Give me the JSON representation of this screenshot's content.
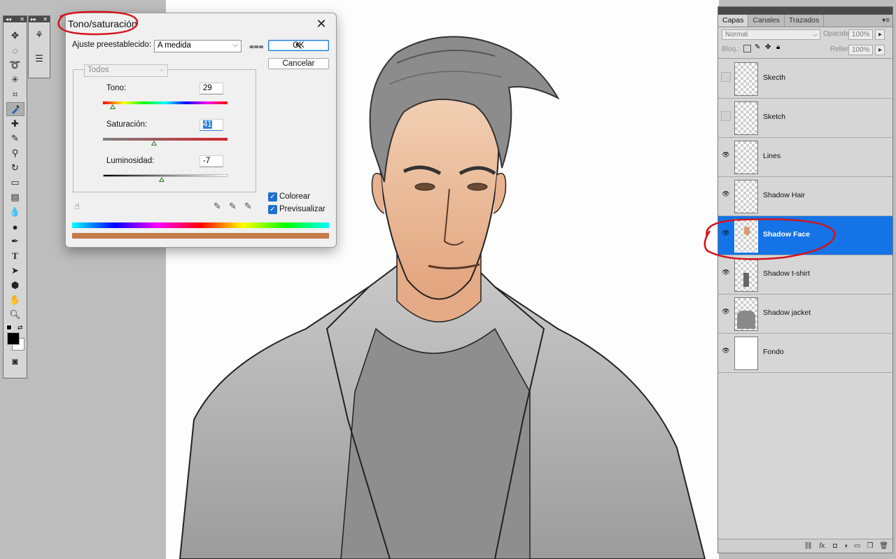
{
  "colors": {
    "accent": "#1473e6",
    "annotation": "#d4141a",
    "dialog_bg": "#f0f0f0",
    "panel_bg": "#d6d6d6",
    "colorize_sample": "#c27a49"
  },
  "dialog": {
    "title": "Tono/saturación",
    "preset_label": "Ajuste preestablecido:",
    "preset_value": "A medida",
    "channel_value": "Todos",
    "ok_label": "OK",
    "cancel_label": "Cancelar",
    "hue": {
      "label": "Tono:",
      "value": "29",
      "fraction": 0.08
    },
    "saturation": {
      "label": "Saturación:",
      "value": "41",
      "fraction": 0.41
    },
    "lightness": {
      "label": "Luminosidad:",
      "value": "-7",
      "fraction": 0.47
    },
    "colorize": {
      "label": "Colorear",
      "checked": true
    },
    "preview": {
      "label": "Previsualizar",
      "checked": true
    }
  },
  "layers_panel": {
    "tabs": [
      "Capas",
      "Canales",
      "Trazados"
    ],
    "blend_mode": "Normal",
    "opacity_label": "Opacidad:",
    "opacity_value": "100%",
    "lock_label": "Bloq.:",
    "fill_label": "Relleno:",
    "fill_value": "100%",
    "layers": [
      {
        "name": "Skecth",
        "visible": false,
        "selected": false
      },
      {
        "name": "Sketch",
        "visible": false,
        "selected": false
      },
      {
        "name": "Lines",
        "visible": true,
        "selected": false
      },
      {
        "name": "Shadow Hair",
        "visible": true,
        "selected": false
      },
      {
        "name": "Shadow Face",
        "visible": true,
        "selected": true
      },
      {
        "name": "Shadow t-shirt",
        "visible": true,
        "selected": false
      },
      {
        "name": "Shadow jacket",
        "visible": true,
        "selected": false
      },
      {
        "name": "Fondo",
        "visible": true,
        "selected": false
      }
    ]
  },
  "icons": {
    "tools": [
      "move-icon",
      "marquee-icon",
      "lasso-icon",
      "magic-wand-icon",
      "crop-icon",
      "eyedropper-icon",
      "healing-icon",
      "brush-icon",
      "stamp-icon",
      "history-brush-icon",
      "eraser-icon",
      "gradient-icon",
      "blur-icon",
      "dodge-icon",
      "pen-icon",
      "type-icon",
      "path-select-icon",
      "shape-icon",
      "hand-icon",
      "zoom-icon"
    ],
    "panel_bottom": [
      "link-icon",
      "fx-icon",
      "mask-icon",
      "adjustment-icon",
      "folder-icon",
      "new-layer-icon",
      "trash-icon"
    ]
  }
}
